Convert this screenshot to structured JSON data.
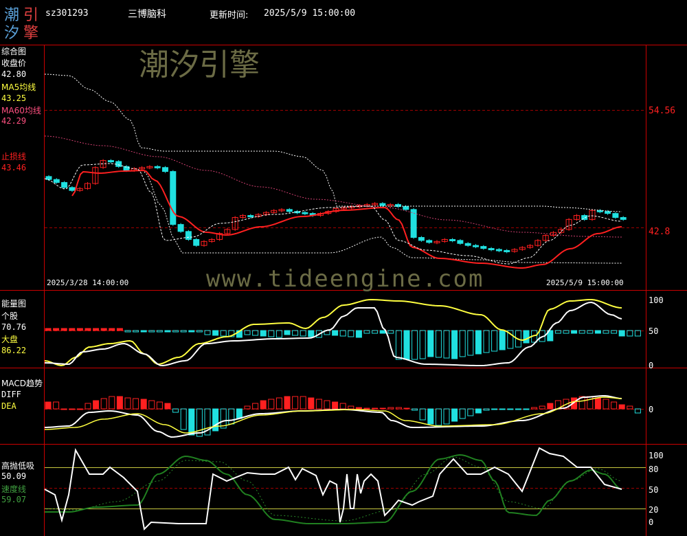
{
  "header": {
    "logo_chars": [
      "潮",
      "引",
      "汐",
      "擎"
    ],
    "code": "sz301293",
    "name": "三博脑科",
    "update_label": "更新时间:",
    "update_time": "2025/5/9 15:00:00"
  },
  "watermarks": {
    "cn": "潮汐引擎",
    "url": "www.tideengine.com"
  },
  "colors": {
    "bg": "#000000",
    "frame": "#cc0000",
    "up": "#ff2020",
    "down": "#20e0e0",
    "ma5": "#ffff40",
    "ma60": "#ff4060",
    "stop": "#ff2020",
    "white": "#ffffff",
    "green": "#208020"
  },
  "panel1": {
    "title": "综合图",
    "close_label": "收盘价",
    "close_value": "42.80",
    "ma5_label": "MA5均线",
    "ma5_value": "43.25",
    "ma60_label": "MA60均线",
    "ma60_value": "42.29",
    "stop_label": "止损线",
    "stop_value": "43.46",
    "right_price_top": "54.56",
    "right_price_bottom": "42.8",
    "start_date": "2025/3/28 14:00:00",
    "end_date": "2025/5/9 15:00:00"
  },
  "panel2": {
    "title": "能量图",
    "stock_label": "个股",
    "stock_value": "70.76",
    "market_label": "大盘",
    "market_value": "86.22",
    "axis": [
      "100",
      "50",
      "0"
    ]
  },
  "panel3": {
    "title": "MACD趋势",
    "diff_label": "DIFF",
    "dea_label": "DEA",
    "axis": [
      "0"
    ]
  },
  "panel4": {
    "title": "高抛低吸",
    "value": "50.09",
    "speed_label": "速度线",
    "speed_value": "59.07",
    "axis": [
      "100",
      "80",
      "50",
      "20",
      "0"
    ]
  },
  "chart_data": [
    {
      "type": "candlestick",
      "title": "综合图",
      "series": [
        {
          "name": "收盘价",
          "values": [
            47.6,
            47.3,
            46.8,
            46.5,
            46.7,
            47.2,
            48.8,
            49.5,
            49.4,
            48.9,
            48.5,
            48.7,
            48.8,
            48.9,
            48.8,
            48.4,
            43.1,
            42.4,
            41.6,
            41.0,
            41.4,
            41.6,
            42.2,
            42.6,
            43.8,
            44.0,
            43.9,
            44.1,
            44.3,
            44.5,
            44.6,
            44.4,
            44.3,
            44.2,
            44.0,
            44.2,
            44.4,
            44.7,
            44.8,
            44.9,
            45.0,
            45.1,
            45.2,
            45.0,
            45.1,
            44.9,
            44.6,
            41.8,
            41.5,
            41.3,
            41.4,
            41.6,
            41.5,
            41.2,
            41.0,
            40.9,
            40.7,
            40.6,
            40.5,
            40.4,
            40.6,
            40.8,
            41.0,
            41.5,
            42.0,
            42.3,
            42.6,
            43.6,
            44.0,
            43.6,
            44.5,
            44.4,
            44.2,
            43.8,
            43.6
          ]
        },
        {
          "name": "MA5均线",
          "values": []
        },
        {
          "name": "MA60均线",
          "values": []
        },
        {
          "name": "止损线",
          "values": []
        }
      ]
    },
    {
      "type": "line",
      "title": "能量图",
      "ylim": [
        0,
        100
      ],
      "series": [
        {
          "name": "个股",
          "last": 70.76
        },
        {
          "name": "大盘",
          "last": 86.22
        }
      ]
    },
    {
      "type": "bar",
      "title": "MACD趋势",
      "series": [
        {
          "name": "DIFF"
        },
        {
          "name": "DEA"
        }
      ]
    },
    {
      "type": "line",
      "title": "高抛低吸",
      "ylim": [
        0,
        100
      ],
      "series": [
        {
          "name": "高抛低吸",
          "last": 50.09
        },
        {
          "name": "速度线",
          "last": 59.07
        }
      ]
    }
  ]
}
